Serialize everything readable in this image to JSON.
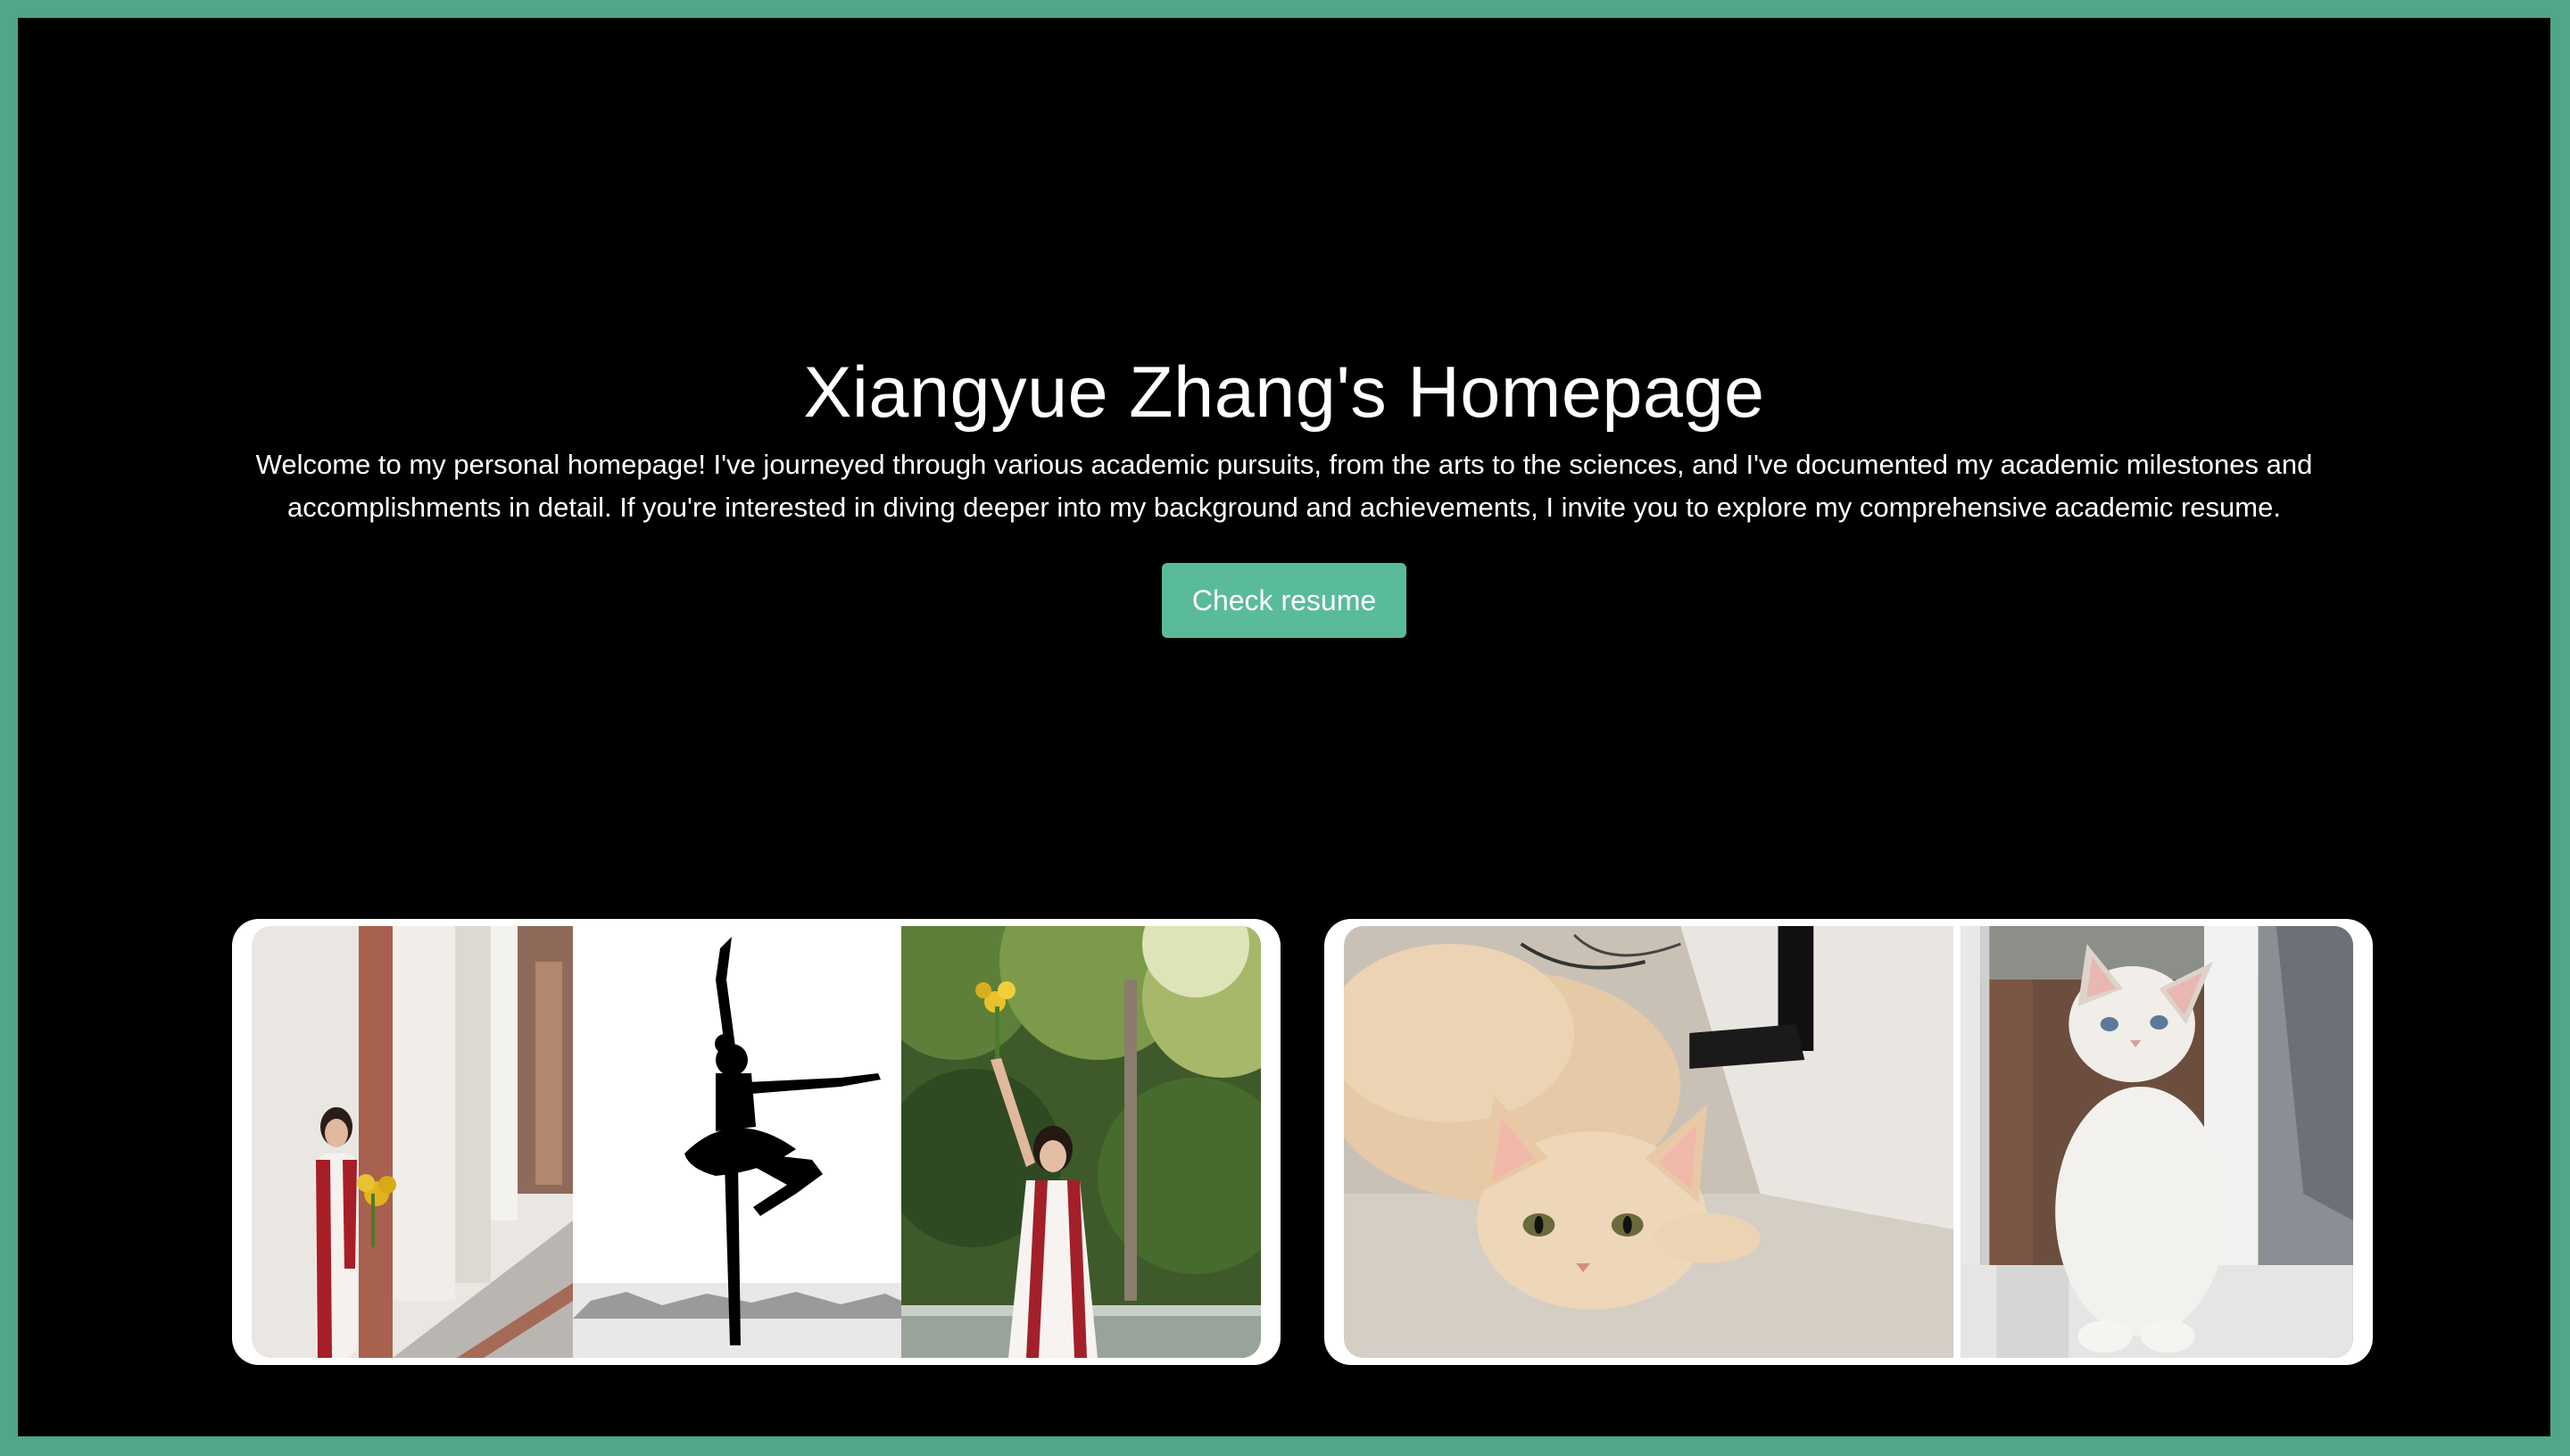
{
  "header": {
    "title": "Xiangyue Zhang's Homepage",
    "intro": "Welcome to my personal homepage! I've journeyed through various academic pursuits, from the arts to the sciences, and I've documented my academic milestones and accomplishments in detail. If you're interested in diving deeper into my background and achievements, I invite you to explore my comprehensive academic resume.",
    "button_label": "Check resume"
  },
  "gallery": {
    "left_card": [
      {
        "icon": "graduation-photo"
      },
      {
        "icon": "ballet-silhouette-photo"
      },
      {
        "icon": "garden-graduation-photo"
      }
    ],
    "right_card": [
      {
        "icon": "cream-cat-photo"
      },
      {
        "icon": "white-cat-window-photo"
      }
    ]
  },
  "colors": {
    "frame": "#4fa68a",
    "button": "#5abb9b",
    "background": "#000000",
    "text": "#ffffff"
  }
}
